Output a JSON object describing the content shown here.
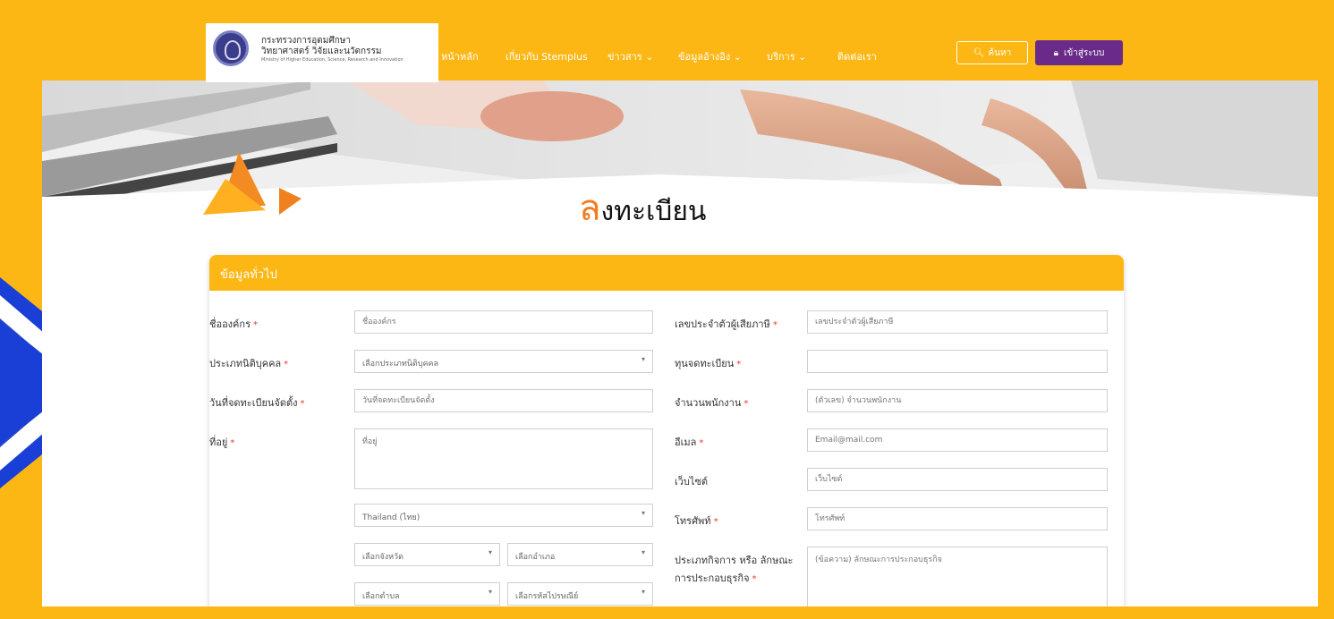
{
  "header": {
    "logo_line1": "กระทรวงการอุดมศึกษา",
    "logo_line2": "วิทยาศาสตร์ วิจัยและนวัตกรรม",
    "logo_line3": "Ministry of Higher Education, Science, Research and Innovation",
    "nav": [
      "หน้าหลัก",
      "เกี่ยวกับ Stemplus",
      "ข่าวสาร",
      "ข้อมูลอ้างอิง",
      "บริการ",
      "ติดต่อเรา"
    ],
    "search_label": "ค้นหา",
    "login_label": "เข้าสู่ระบบ"
  },
  "page_title_first": "ล",
  "page_title_rest": "งทะเบียน",
  "section_title": "ข้อมูลทั่วไป",
  "form": {
    "org_name_label": "ชื่อองค์กร",
    "org_name_placeholder": "ชื่อองค์กร",
    "entity_type_label": "ประเภทนิติบุคคล",
    "entity_type_value": "เลือกประเภทนิติบุคคล",
    "reg_date_label": "วันที่จดทะเบียนจัดตั้ง",
    "reg_date_placeholder": "วันที่จดทะเบียนจัดตั้ง",
    "address_label": "ที่อยู่",
    "address_placeholder": "ที่อยู่",
    "country_value": "Thailand (ไทย)",
    "province_value": "เลือกจังหวัด",
    "district_value": "เลือกอำเภอ",
    "subdistrict_value": "เลือกตำบล",
    "postcode_value": "เลือกรหัสไปรษณีย์",
    "tax_id_label": "เลขประจำตัวผู้เสียภาษี",
    "tax_id_placeholder": "เลขประจำตัวผู้เสียภาษี",
    "capital_label": "ทุนจดทะเบียน",
    "employees_label": "จำนวนพนักงาน",
    "employees_placeholder": "(ตัวเลข) จำนวนพนักงาน",
    "email_label": "อีเมล",
    "email_placeholder": "Email@mail.com",
    "website_label": "เว็บไซต์",
    "website_placeholder": "เว็บไซต์",
    "phone_label": "โทรศัพท์",
    "phone_placeholder": "โทรศัพท์",
    "business_label_1": "ประเภทกิจการ หรือ ลักษณะ",
    "business_label_2": "การประกอบธุรกิจ",
    "business_placeholder": "(ข้อความ) ลักษณะการประกอบธุรกิจ",
    "required_mark": "*"
  },
  "colors": {
    "brand_yellow": "#FDB715",
    "login_purple": "#6a2a8a",
    "title_orange": "#f47b20",
    "chevron_blue": "#1a3fd6"
  }
}
